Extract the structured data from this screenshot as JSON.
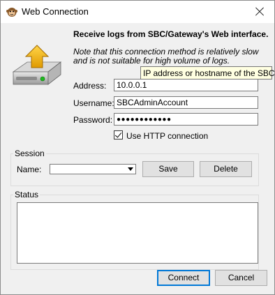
{
  "window": {
    "title": "Web Connection",
    "app_icon": "monkey-icon"
  },
  "header": {
    "heading": "Receive logs from SBC/Gateway's Web interface.",
    "note": "Note that this connection method is relatively slow and is not suitable for high volume of logs."
  },
  "form": {
    "address_label": "Address:",
    "address_value": "10.0.0.1",
    "address_tooltip": "IP address or hostname of the SBC",
    "username_label": "Username:",
    "username_value": "SBCAdminAccount",
    "password_label": "Password:",
    "password_value": "●●●●●●●●●●●●",
    "use_http_label": "Use HTTP connection",
    "use_http_checked": true
  },
  "session": {
    "group_title": "Session",
    "name_label": "Name:",
    "name_value": "",
    "save_label": "Save",
    "delete_label": "Delete"
  },
  "status": {
    "group_title": "Status",
    "text": ""
  },
  "footer": {
    "connect_label": "Connect",
    "cancel_label": "Cancel"
  },
  "colors": {
    "accent": "#0078d7",
    "tooltip_bg": "#ffffe1",
    "arrow_yellow": "#f5b400"
  }
}
